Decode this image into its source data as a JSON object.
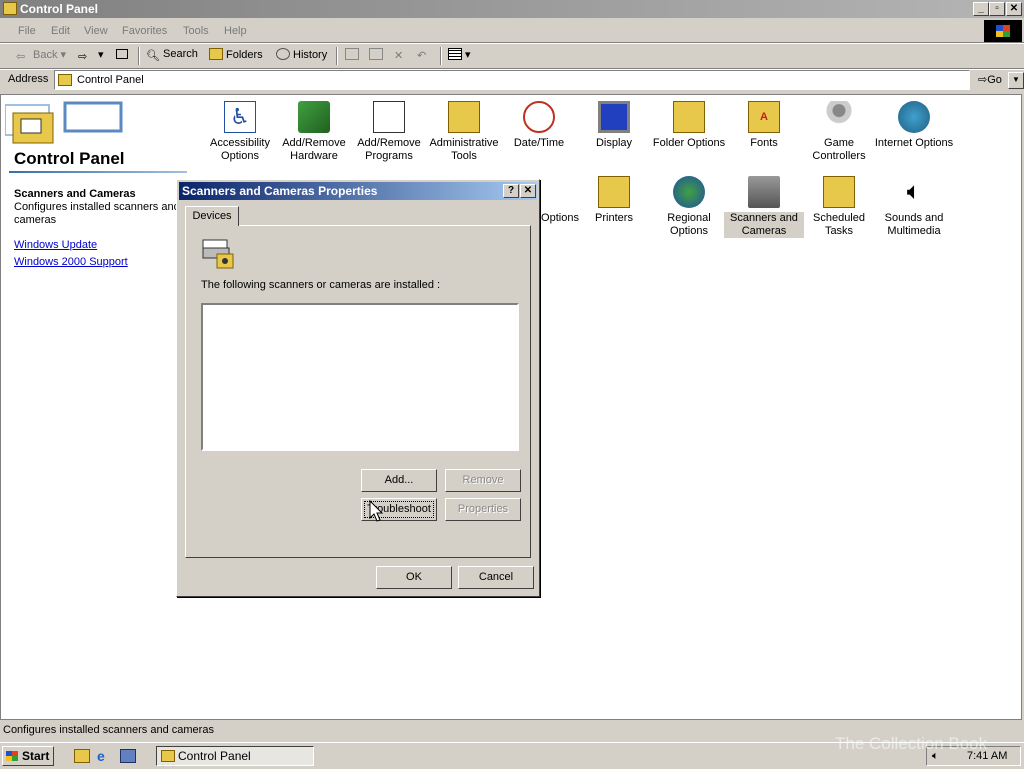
{
  "window": {
    "title": "Control Panel"
  },
  "menu": [
    "File",
    "Edit",
    "View",
    "Favorites",
    "Tools",
    "Help"
  ],
  "toolbar": {
    "back": "Back",
    "search": "Search",
    "folders": "Folders",
    "history": "History"
  },
  "address": {
    "label": "Address",
    "value": "Control Panel",
    "go": "Go"
  },
  "sidebar": {
    "title": "Control Panel",
    "selected_title": "Scanners and Cameras",
    "selected_desc": "Configures installed scanners and cameras",
    "links": [
      "Windows Update",
      "Windows 2000 Support"
    ]
  },
  "icons": [
    {
      "label": "Accessibility Options",
      "icon": "accessibility-icon"
    },
    {
      "label": "Add/Remove Hardware",
      "icon": "hardware-icon"
    },
    {
      "label": "Add/Remove Programs",
      "icon": "programs-icon"
    },
    {
      "label": "Administrative Tools",
      "icon": "admin-tools-icon"
    },
    {
      "label": "Date/Time",
      "icon": "clock-icon"
    },
    {
      "label": "Display",
      "icon": "display-icon"
    },
    {
      "label": "Folder Options",
      "icon": "folder-options-icon"
    },
    {
      "label": "Fonts",
      "icon": "fonts-icon"
    },
    {
      "label": "Game Controllers",
      "icon": "joystick-icon"
    },
    {
      "label": "Internet Options",
      "icon": "globe-icon"
    },
    {
      "label": "Options",
      "icon": "options-icon"
    },
    {
      "label": "Printers",
      "icon": "printer-icon"
    },
    {
      "label": "Regional Options",
      "icon": "globe-icon"
    },
    {
      "label": "Scanners and Cameras",
      "icon": "scanner-icon"
    },
    {
      "label": "Scheduled Tasks",
      "icon": "tasks-icon"
    },
    {
      "label": "Sounds and Multimedia",
      "icon": "speaker-icon"
    }
  ],
  "status": "Configures installed scanners and cameras",
  "taskbar": {
    "start": "Start",
    "task": "Control Panel",
    "clock": "7:41 AM",
    "watermark": "The Collection Book"
  },
  "dialog": {
    "title": "Scanners and Cameras Properties",
    "tab": "Devices",
    "label": "The following scanners or cameras are installed :",
    "buttons": {
      "add": "Add...",
      "remove": "Remove",
      "troubleshoot": "Troubleshoot",
      "properties": "Properties",
      "ok": "OK",
      "cancel": "Cancel"
    }
  }
}
